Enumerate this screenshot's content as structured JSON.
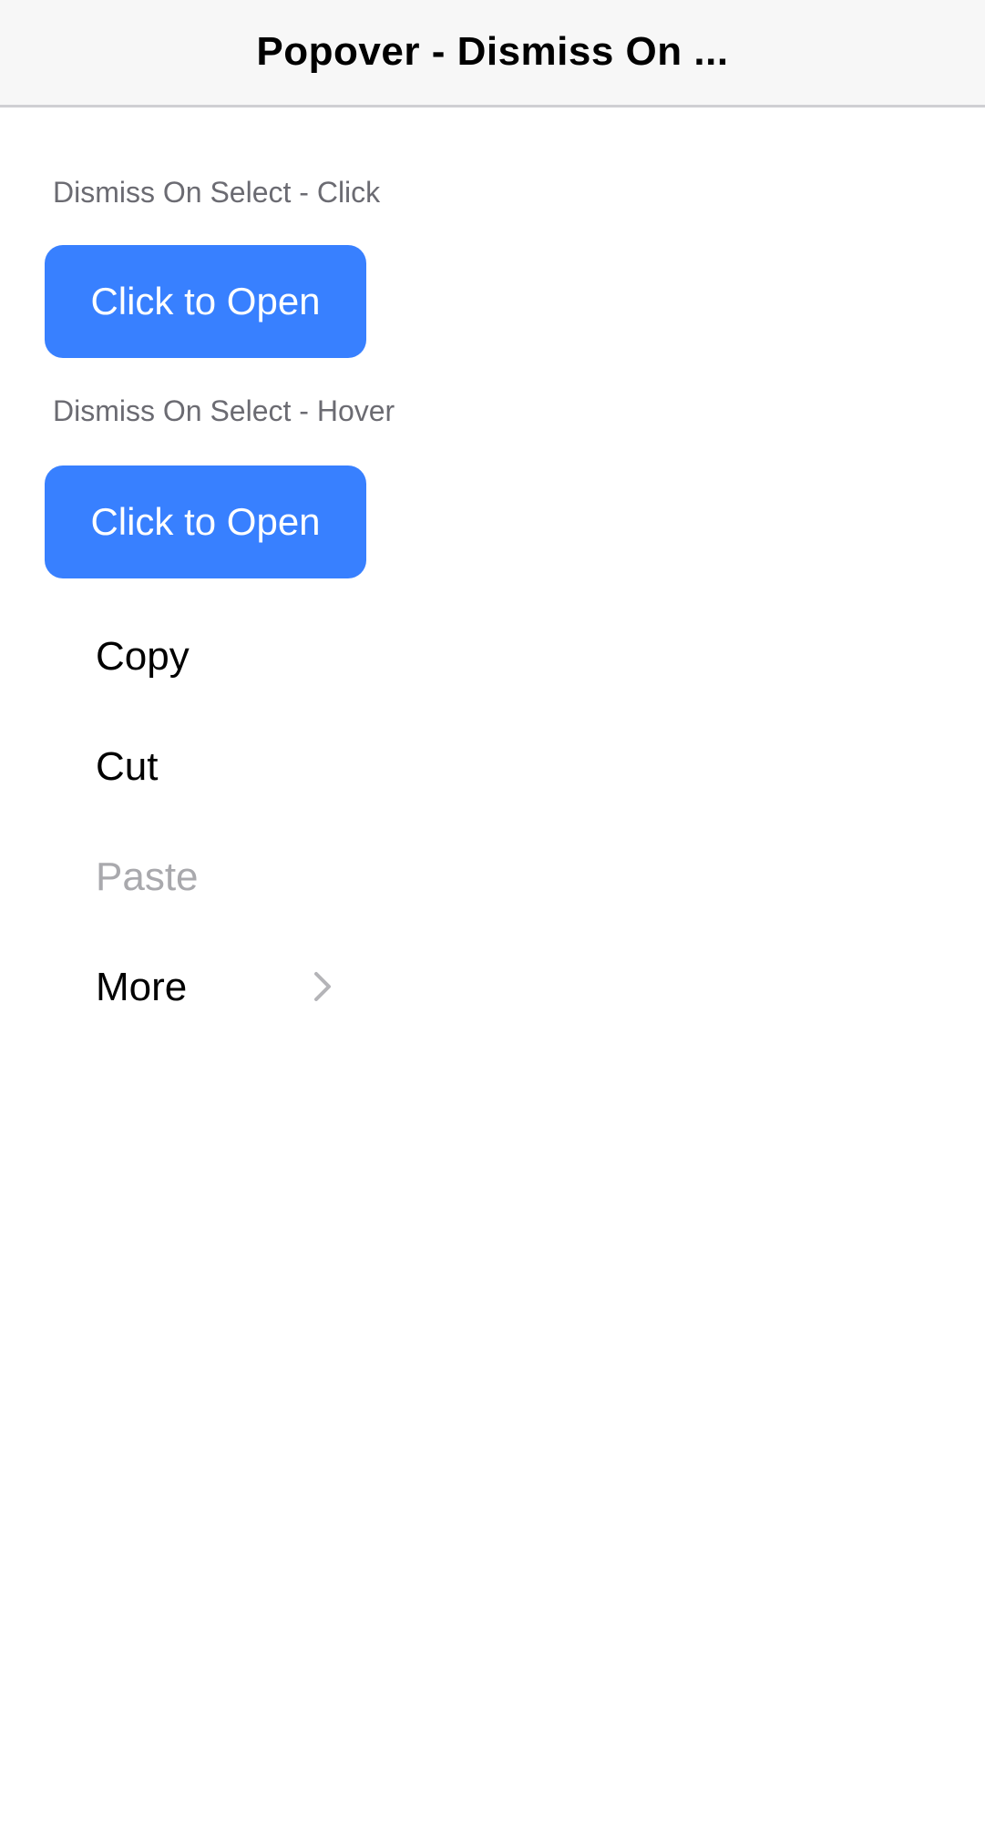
{
  "header": {
    "title": "Popover - Dismiss On ..."
  },
  "sections": [
    {
      "label": "Dismiss On Select - Click",
      "button_label": "Click to Open"
    },
    {
      "label": "Dismiss On Select - Hover",
      "button_label": "Click to Open"
    }
  ],
  "menu": {
    "items": [
      {
        "label": "Copy",
        "disabled": false
      },
      {
        "label": "Cut",
        "disabled": false
      },
      {
        "label": "Paste",
        "disabled": true
      },
      {
        "label": "More",
        "disabled": false,
        "icon": "chevron-right-icon"
      }
    ]
  },
  "colors": {
    "accent": "#3880ff",
    "header_bg": "#f7f7f7",
    "label_gray": "#6b6b72",
    "disabled_text": "#a9a9ad"
  }
}
